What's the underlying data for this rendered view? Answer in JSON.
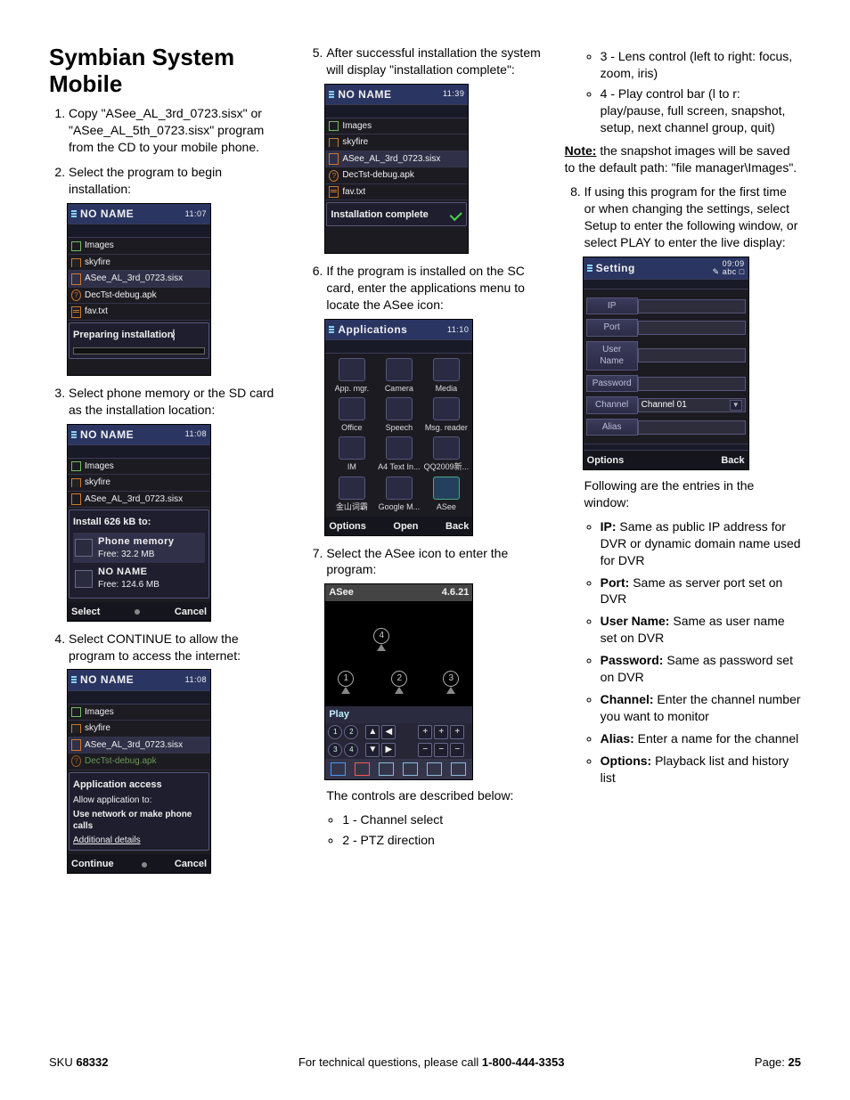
{
  "title": "Symbian System Mobile",
  "steps": {
    "s1": "Copy \"ASee_AL_3rd_0723.sisx\" or \"ASee_AL_5th_0723.sisx\" program from the CD to your mobile phone.",
    "s2": "Select the program to begin installation:",
    "s3": "Select phone memory or the SD card as the installation location:",
    "s4": "Select CONTINUE to allow the program to access the internet:",
    "s5": "After successful installation the system will display \"installation complete\":",
    "s6": "If the program is installed on the SC card, enter the applications menu to locate the ASee icon:",
    "s7": "Select the ASee icon to enter the program:",
    "s7_after": "The controls are described below:",
    "s8": "If using this program for the first time or when changing the settings, select Setup to enter the following window, or select PLAY to enter the live display:",
    "s8_after": "Following are the entries in the window:"
  },
  "controls": {
    "c1": "1 - Channel select",
    "c2": "2 - PTZ direction",
    "c3": "3 - Lens control (left to right: focus, zoom, iris)",
    "c4": "4 - Play control bar (l to r: play/pause, full screen, snapshot, setup, next channel group, quit)"
  },
  "note_label": "Note:",
  "note": " the snapshot images will be saved to the default path: \"file manager\\Images\".",
  "entries": {
    "ip_b": "IP:",
    "ip": " Same as public IP address for DVR or dynamic domain name used for DVR",
    "port_b": "Port:",
    "port": " Same as server port set on DVR",
    "user_b": "User Name:",
    "user": " Same as user name set on DVR",
    "pass_b": "Password:",
    "pass": " Same as password set on DVR",
    "chan_b": "Channel:",
    "chan": " Enter the channel number you want to monitor",
    "alias_b": "Alias:",
    "alias": " Enter a name for the channel",
    "opt_b": "Options:",
    "opt": " Playback list and history list"
  },
  "shot_common": {
    "title_noname": "NO NAME",
    "images": "Images",
    "skyfire": "skyfire",
    "asee_sisx": "ASee_AL_3rd_0723.sisx",
    "dectst": "DecTst-debug.apk",
    "favtxt": "fav.txt",
    "select": "Select",
    "cancel": "Cancel",
    "continue": "Continue",
    "open": "Open",
    "options": "Options",
    "back": "Back"
  },
  "shot2": {
    "status": "Preparing installation",
    "clock": "11:07"
  },
  "shot3": {
    "clock": "11:08",
    "panel_title": "Install 626 kB to:",
    "opt1": "Phone memory",
    "opt1_sub": "Free: 32.2 MB",
    "opt2": "NO NAME",
    "opt2_sub": "Free: 124.6 MB"
  },
  "shot4": {
    "clock": "11:08",
    "panel_title": "Application access",
    "line1": "Allow application to:",
    "line2": "Use network or make phone calls",
    "line3": "Additional details"
  },
  "shot5": {
    "clock": "11:39",
    "status": "Installation complete"
  },
  "shot6": {
    "title": "Applications",
    "clock": "11:10",
    "apps": [
      "App. mgr.",
      "Camera",
      "Media",
      "Office",
      "Speech",
      "Msg. reader",
      "IM",
      "A4 Text In...",
      "QQ2009新...",
      "金山词霸",
      "Google M...",
      "ASee"
    ]
  },
  "shot7": {
    "title": "ASee",
    "ver": "4.6.21",
    "play": "Play",
    "m1": "1",
    "m2": "2",
    "m3": "3",
    "m4": "4",
    "b1": "1",
    "b2": "2",
    "b3": "3",
    "b4": "4"
  },
  "shot8": {
    "title": "Setting",
    "clock": "09:09",
    "abc": "abc",
    "l_ip": "IP",
    "l_port": "Port",
    "l_user": "User Name",
    "l_pass": "Password",
    "l_chan": "Channel",
    "l_alias": "Alias",
    "v_chan": "Channel 01"
  },
  "footer": {
    "left_a": "SKU ",
    "left_b": "68332",
    "mid_a": "For technical questions, please call ",
    "mid_b": "1-800-444-3353",
    "right_a": "Page: ",
    "right_b": "25"
  }
}
